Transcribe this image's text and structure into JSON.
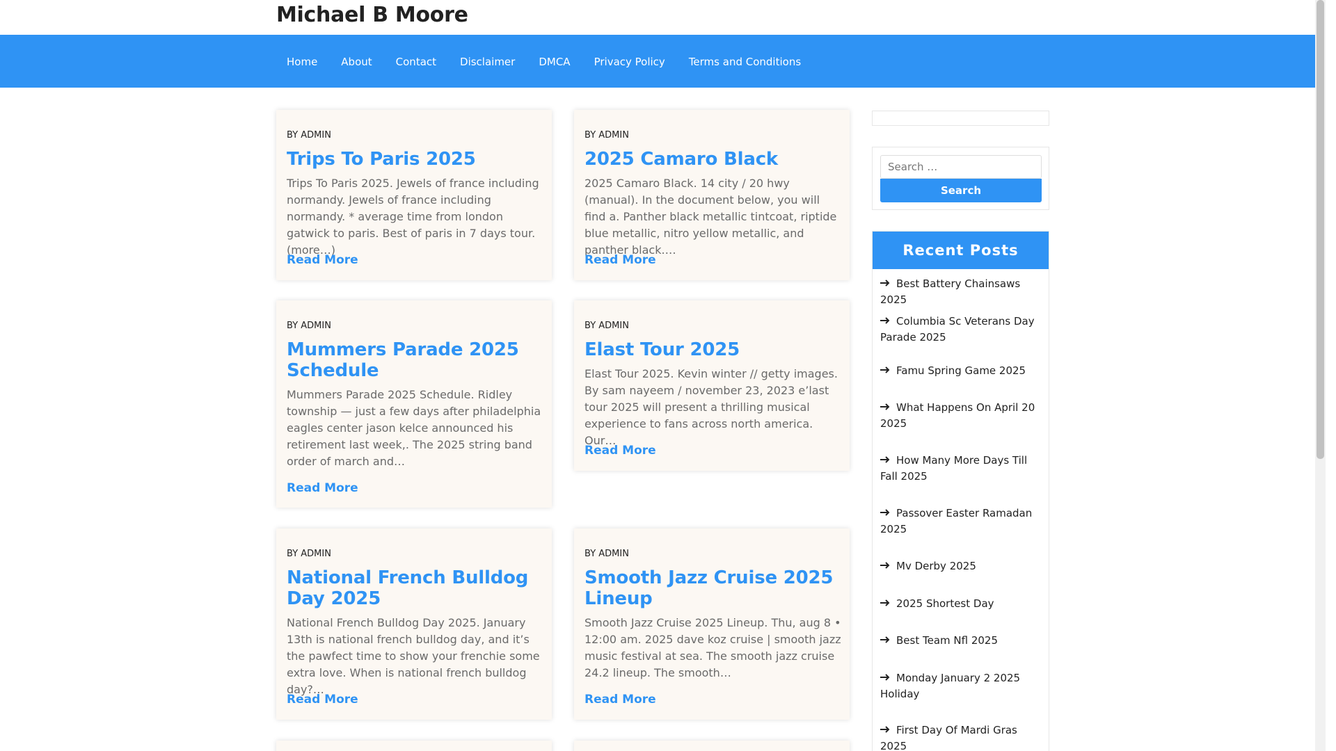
{
  "site": {
    "title": "Michael B Moore"
  },
  "nav": {
    "items": [
      "Home",
      "About",
      "Contact",
      "Disclaimer",
      "DMCA",
      "Privacy Policy",
      "Terms and Conditions"
    ]
  },
  "posts": [
    {
      "by": "BY ADMIN",
      "title": "Trips To Paris 2025",
      "excerpt": "Trips To Paris 2025. Jewels of france including normandy. Jewels of france including normandy. * average time from london gatwick to paris. Best of paris in 7 days tour. (more…)",
      "read_more": "Read More"
    },
    {
      "by": "BY ADMIN",
      "title": "2025 Camaro Black",
      "excerpt": "2025 Camaro Black. 14 city / 20 hwy (manual). In the document below, you will find a. Panther black metallic tintcoat, riptide blue metallic, nitro yellow metallic, and panther black.…",
      "read_more": "Read More"
    },
    {
      "by": "BY ADMIN",
      "title": "Mummers Parade 2025 Schedule",
      "excerpt": "Mummers Parade 2025 Schedule. Ridley township — just a few days after philadelphia eagles center jason kelce announced his retirement last week,. The 2025 string band order of march and…",
      "read_more": "Read More"
    },
    {
      "by": "BY ADMIN",
      "title": "Elast Tour 2025",
      "excerpt": "Elast Tour 2025. Kevin winter // getty images. By sam nayeem / november 23, 2023 e’last tour 2025 will present a thrilling musical experience to fans across north america. Our…",
      "read_more": "Read More"
    },
    {
      "by": "BY ADMIN",
      "title": "National French Bulldog Day 2025",
      "excerpt": "National French Bulldog Day 2025. January 13th is national french bulldog day, and it’s the pawfect time to show your frenchie some extra love. When is national french bulldog day?…",
      "read_more": "Read More"
    },
    {
      "by": "BY ADMIN",
      "title": "Smooth Jazz Cruise 2025 Lineup",
      "excerpt": "Smooth Jazz Cruise 2025 Lineup. Thu, aug 8 • 12:00 am. 2025 dave koz cruise | smooth jazz music festival at sea. The smooth jazz cruise 24.2 lineup. The smooth…",
      "read_more": "Read More"
    }
  ],
  "search": {
    "placeholder": "Search …",
    "button_label": "Search"
  },
  "recent_posts": {
    "heading": "Recent Posts",
    "items": [
      "Best Battery Chainsaws 2025",
      "Columbia Sc Veterans Day Parade 2025",
      "Famu Spring Game 2025",
      "What Happens On April 20 2025",
      "How Many More Days Till Fall 2025",
      "Passover Easter Ramadan 2025",
      "Mv Derby 2025",
      "2025 Shortest Day",
      "Best Team Nfl 2025",
      "Monday January 2 2025 Holiday",
      "First Day Of Mardi Gras 2025"
    ]
  },
  "colors": {
    "accent": "#2f93f4",
    "card_bg": "#fcf8f3"
  },
  "icons": {
    "recent_post_bullet": "arrow-right-icon"
  }
}
